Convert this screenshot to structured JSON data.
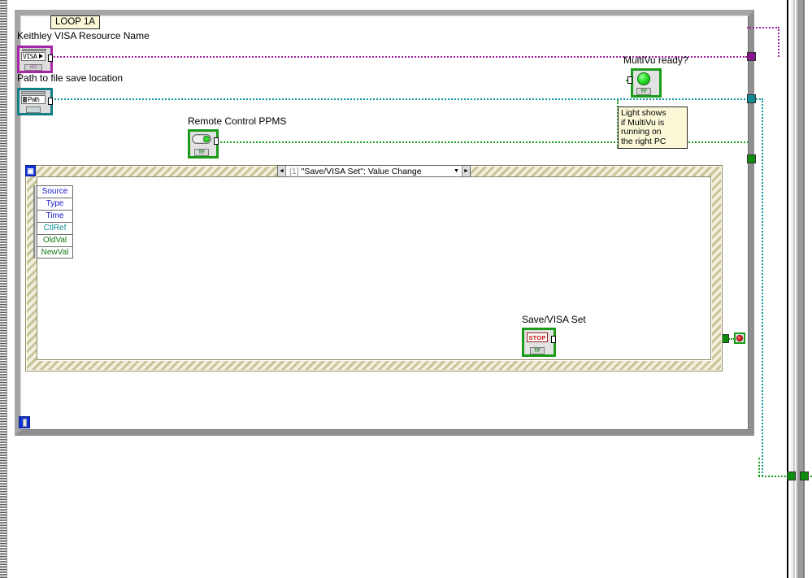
{
  "diagram": {
    "type": "labview-block-diagram",
    "loop": {
      "name": "LOOP 1A",
      "label": "LOOP 1A"
    },
    "labels": {
      "visa_resource": "Keithley VISA Resource Name",
      "file_path": "Path to file save location",
      "remote_control": "Remote Control PPMS",
      "multivu_ready": "MultiVu ready?",
      "save_visa_set": "Save/VISA Set"
    },
    "terminals": {
      "visa": {
        "text": "VISA",
        "datatype_tag": "I/O",
        "border_color": "#a626a6"
      },
      "path": {
        "text": "Path",
        "datatype_tag": "",
        "border_color": "#117f85"
      },
      "remote_control": {
        "datatype_tag": "TF",
        "border_color": "#1a9b1a"
      },
      "multivu_ready": {
        "datatype_tag": "TF",
        "border_color": "#1a9b1a"
      },
      "save_visa_set": {
        "text": "STOP",
        "datatype_tag": "TF",
        "border_color": "#1a9b1a"
      }
    },
    "comment": {
      "lines": [
        "Light shows",
        "if MultiVu is",
        "running on",
        "the right PC"
      ],
      "text": "Light shows if MultiVu is running on the right PC"
    },
    "event_structure": {
      "icon": "event-structure-icon",
      "selector": {
        "index": "[1]",
        "event": "\"Save/VISA Set\": Value Change",
        "left_arrow": "◄",
        "right_arrow": "►",
        "dropdown_arrow": "▼"
      },
      "event_data_node": [
        {
          "label": "Source",
          "color": "#1414cf"
        },
        {
          "label": "Type",
          "color": "#1414cf"
        },
        {
          "label": "Time",
          "color": "#1414cf"
        },
        {
          "label": "CtlRef",
          "color": "#0f8f96"
        },
        {
          "label": "OldVal",
          "color": "#117a11"
        },
        {
          "label": "NewVal",
          "color": "#117a11"
        }
      ]
    },
    "iteration_terminal": {
      "label": "i"
    },
    "stop_condition": {
      "name": "stop-if-true"
    },
    "wire_colors": {
      "visa": "#a020a0",
      "path": "#0f9aa0",
      "boolean": "#17a017"
    }
  }
}
